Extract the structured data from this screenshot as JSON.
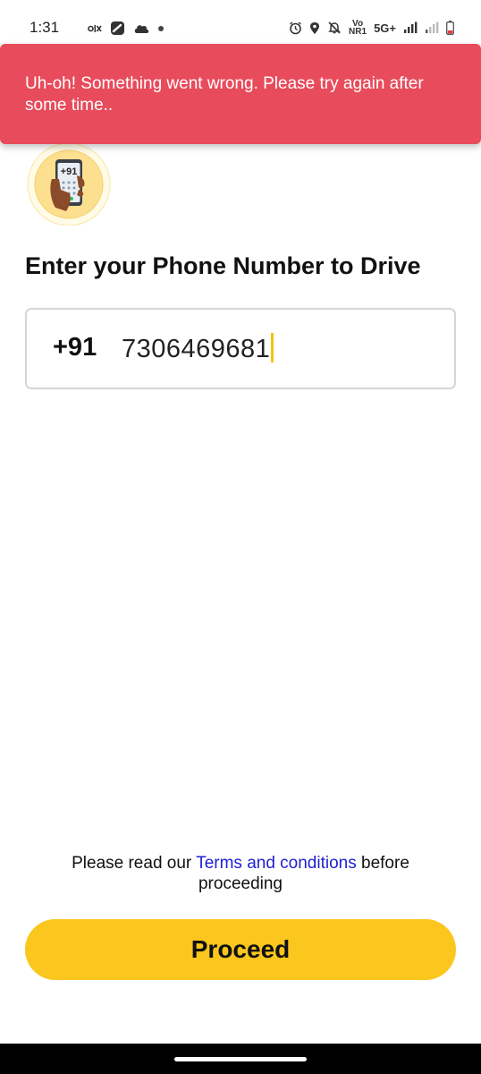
{
  "status_bar": {
    "time": "1:31",
    "left_icons": [
      "olx-icon",
      "dash-app-icon",
      "cloud-icon",
      "dot-icon"
    ],
    "volte_top": "Vo",
    "volte_bottom": "NR1",
    "network": "5G+",
    "right_icons": [
      "alarm-icon",
      "location-icon",
      "mute-icon",
      "signal-icon",
      "signal-icon-2",
      "battery-low-icon"
    ]
  },
  "error_banner": {
    "message": "Uh-oh! Something went wrong. Please try again after some time..",
    "color": "#e84b5b"
  },
  "illustration": {
    "phone_label": "+91"
  },
  "page": {
    "title": "Enter your Phone Number to Drive"
  },
  "phone_input": {
    "country_code": "+91",
    "value": "7306469681"
  },
  "terms": {
    "prefix": "Please read our ",
    "link": "Terms and conditions",
    "suffix": " before proceeding"
  },
  "proceed_button": {
    "label": "Proceed",
    "color": "#fbc61d"
  }
}
